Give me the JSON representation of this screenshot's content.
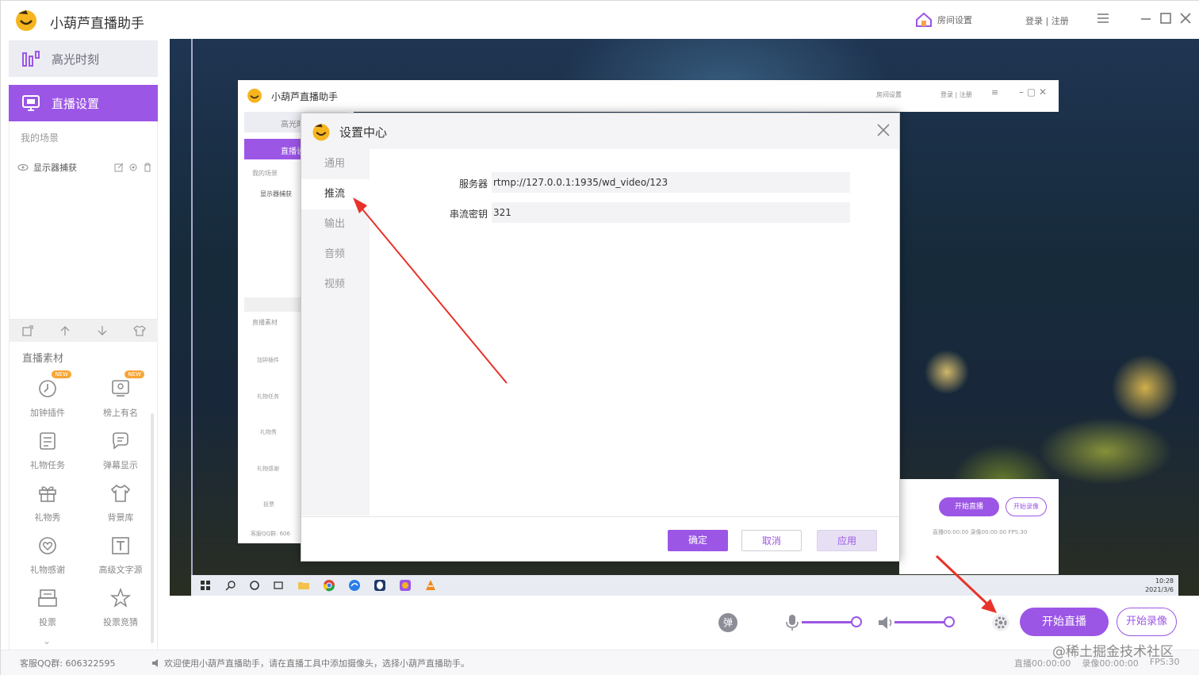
{
  "app": {
    "title": "小葫芦直播助手",
    "room_settings": "房间设置",
    "login_register": "登录 | 注册"
  },
  "sidebar": {
    "highlight_label": "高光时刻",
    "live_settings_label": "直播设置",
    "my_scenes_label": "我的场景",
    "scene_items": [
      "显示器捕获"
    ],
    "materials_title": "直播素材",
    "materials": [
      {
        "label": "加钟插件",
        "icon": "clock-plugin-icon",
        "new": true
      },
      {
        "label": "榜上有名",
        "icon": "leaderboard-icon",
        "new": true
      },
      {
        "label": "礼物任务",
        "icon": "gift-task-icon",
        "new": false
      },
      {
        "label": "弹幕显示",
        "icon": "danmaku-icon",
        "new": false
      },
      {
        "label": "礼物秀",
        "icon": "gift-show-icon",
        "new": false
      },
      {
        "label": "背景库",
        "icon": "shirt-icon",
        "new": false
      },
      {
        "label": "礼物感谢",
        "icon": "heart-gift-icon",
        "new": false
      },
      {
        "label": "高级文字源",
        "icon": "text-source-icon",
        "new": false
      },
      {
        "label": "投票",
        "icon": "vote-icon",
        "new": false
      },
      {
        "label": "投票竞猜",
        "icon": "star-vote-icon",
        "new": false
      }
    ],
    "badge_new": "NEW"
  },
  "nested_window": {
    "title": "小葫芦直播助手",
    "room_settings": "房间设置",
    "login_register": "登录 | 注册",
    "highlight": "高光时",
    "live": "直播设",
    "my_scenes": "我的场景",
    "scene_item": "显示器捕获",
    "materials_title": "直播素材",
    "materials": [
      "加钟插件",
      "礼物任务",
      "礼物秀",
      "礼物感谢",
      "投票"
    ],
    "qq": "客服QQ群: 606",
    "start_live": "开始直播",
    "start_record": "开始录像",
    "stats": "直播00:00:00   录像00:00:00   FPS:30"
  },
  "taskbar": {
    "time": "10:28",
    "date": "2021/3/6"
  },
  "dialog": {
    "title": "设置中心",
    "nav": [
      "通用",
      "推流",
      "输出",
      "音频",
      "视频"
    ],
    "active_nav": "推流",
    "server_label": "服务器",
    "server_value": "rtmp://127.0.0.1:1935/wd_video/123",
    "key_label": "串流密钥",
    "key_value": "321",
    "ok": "确定",
    "cancel": "取消",
    "apply": "应用"
  },
  "controls": {
    "danmaku": "弹",
    "mic_level": 1.0,
    "speaker_level": 1.0,
    "start_live": "开始直播",
    "start_record": "开始录像"
  },
  "status": {
    "qq_group": "客服QQ群:   606322595",
    "welcome": "欢迎使用小葫芦直播助手，请在直播工具中添加摄像头，选择小葫芦直播助手。",
    "live_time": "直播00:00:00",
    "record_time": "录像00:00:00",
    "fps": "FPS:30",
    "watermark": "@稀土掘金技术社区"
  },
  "colors": {
    "accent": "#9c56e6",
    "arrow": "#e8322a"
  }
}
